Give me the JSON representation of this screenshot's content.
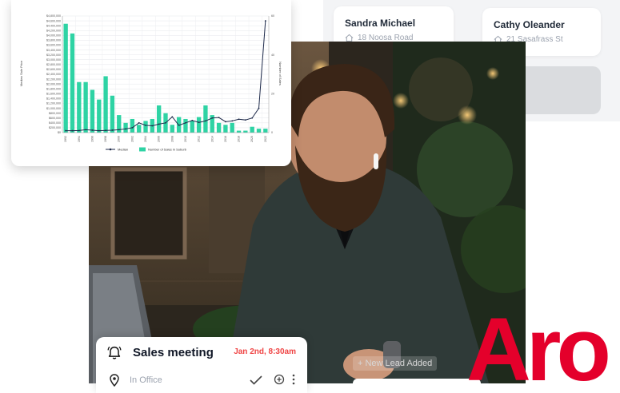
{
  "contacts": [
    {
      "name": "Sandra Michael",
      "address": "18 Noosa Road"
    },
    {
      "name": "Cathy Oleander",
      "address": "21 Sasafrass St"
    }
  ],
  "chart_data": {
    "type": "bar",
    "title": "",
    "categories": [
      "1992",
      "1993",
      "1994",
      "1995",
      "1996",
      "1997",
      "1998",
      "1999",
      "2000",
      "2001",
      "2002",
      "2003",
      "2004",
      "2005",
      "2006",
      "2007",
      "2008",
      "2009",
      "2010",
      "2011",
      "2012",
      "2013",
      "2014",
      "2015",
      "2016",
      "2017",
      "2018",
      "2019",
      "2020",
      "2021",
      "2022"
    ],
    "x_tick_labels": [
      "1992",
      "1994",
      "1996",
      "1998",
      "2000",
      "2002",
      "2004",
      "2006",
      "2008",
      "2010",
      "2012",
      "2014",
      "2016",
      "2018",
      "2020",
      "2022"
    ],
    "series": [
      {
        "name": "Number of Sales in Suburb",
        "axis": "right",
        "kind": "bar",
        "values": [
          56,
          51,
          26,
          26,
          22,
          17,
          29,
          19,
          9,
          5,
          7,
          4,
          6,
          7,
          14,
          10,
          4,
          8,
          7,
          6,
          8,
          14,
          9,
          5,
          4,
          5,
          1,
          1,
          3,
          2,
          2
        ]
      },
      {
        "name": "Median",
        "axis": "left",
        "kind": "line",
        "values": [
          80000,
          80000,
          85000,
          120000,
          100000,
          80000,
          90000,
          100000,
          120000,
          150000,
          200000,
          400000,
          300000,
          280000,
          350000,
          400000,
          650000,
          300000,
          400000,
          500000,
          420000,
          480000,
          600000,
          620000,
          450000,
          480000,
          550000,
          520000,
          600000,
          1000000,
          4600000
        ]
      }
    ],
    "ylabel": "Median Sale Price",
    "y2label": "Number of Sales",
    "ylim": [
      0,
      4800000
    ],
    "y2lim": [
      0,
      60
    ],
    "y_ticks": [
      "$0",
      "$200,000",
      "$400,000",
      "$600,000",
      "$800,000",
      "$1,000,000",
      "$1,200,000",
      "$1,400,000",
      "$1,600,000",
      "$1,800,000",
      "$2,000,000",
      "$2,200,000",
      "$2,400,000",
      "$2,600,000",
      "$2,800,000",
      "$3,000,000",
      "$3,200,000",
      "$3,400,000",
      "$3,600,000",
      "$3,800,000",
      "$4,000,000",
      "$4,200,000",
      "$4,400,000",
      "$4,600,000",
      "$4,800,000"
    ],
    "y2_ticks": [
      "0",
      "20",
      "40",
      "60"
    ],
    "grid": true,
    "legend": "bottom",
    "colors": {
      "bar": "#2ed3a4",
      "line": "#1e2a4a"
    }
  },
  "meeting": {
    "title": "Sales meeting",
    "date": "Jan 2nd, 8:30am",
    "location": "In Office"
  },
  "toast": {
    "text": "+ New Lead Added"
  },
  "logo": {
    "text": "Aro",
    "color": "#e4002b"
  }
}
